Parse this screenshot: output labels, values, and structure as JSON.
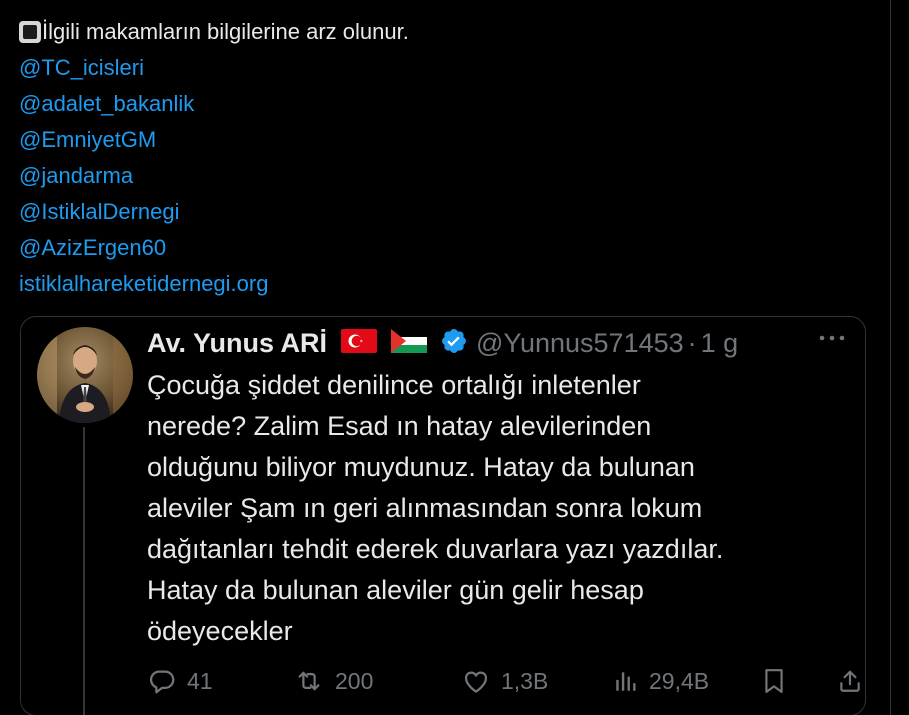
{
  "tweet": {
    "first_line": "İlgili makamların bilgilerine arz olunur.",
    "mentions": [
      "@TC_icisleri",
      "@adalet_bakanlik",
      "@EmniyetGM",
      "@jandarma",
      "@IstiklalDernegi",
      "@AzizErgen60"
    ],
    "link": "istiklalhareketidernegi.org"
  },
  "quote": {
    "display_name": "Av. Yunus ARİ",
    "handle": "@Yunnus571453",
    "dot": "·",
    "time": "1 g",
    "body_lines": [
      "Çocuğa şiddet denilince ortalığı inletenler",
      "nerede? Zalim Esad ın hatay alevilerinden",
      "olduğunu biliyor muydunuz. Hatay da bulunan",
      "aleviler Şam ın geri alınmasından sonra lokum",
      "dağıtanları tehdit ederek duvarlara yazı yazdılar.",
      "Hatay da bulunan aleviler gün gelir hesap",
      "ödeyecekler"
    ],
    "actions": {
      "reply_count": "41",
      "retweet_count": "200",
      "like_count": "1,3B",
      "views_count": "29,4B"
    }
  },
  "colors": {
    "background": "#000000",
    "text": "#e7e9ea",
    "link": "#1d9bf0",
    "muted": "#71767b",
    "border": "#2f3336",
    "verified": "#1d9bf0"
  },
  "icons": {
    "emoji": "black-square-button-icon",
    "flags": [
      "turkey-flag-icon",
      "palestine-flag-icon"
    ],
    "verified": "verified-badge-icon",
    "more": "more-options-icon",
    "actions": [
      "reply-icon",
      "retweet-icon",
      "like-icon",
      "views-icon",
      "bookmark-icon",
      "share-icon"
    ]
  }
}
